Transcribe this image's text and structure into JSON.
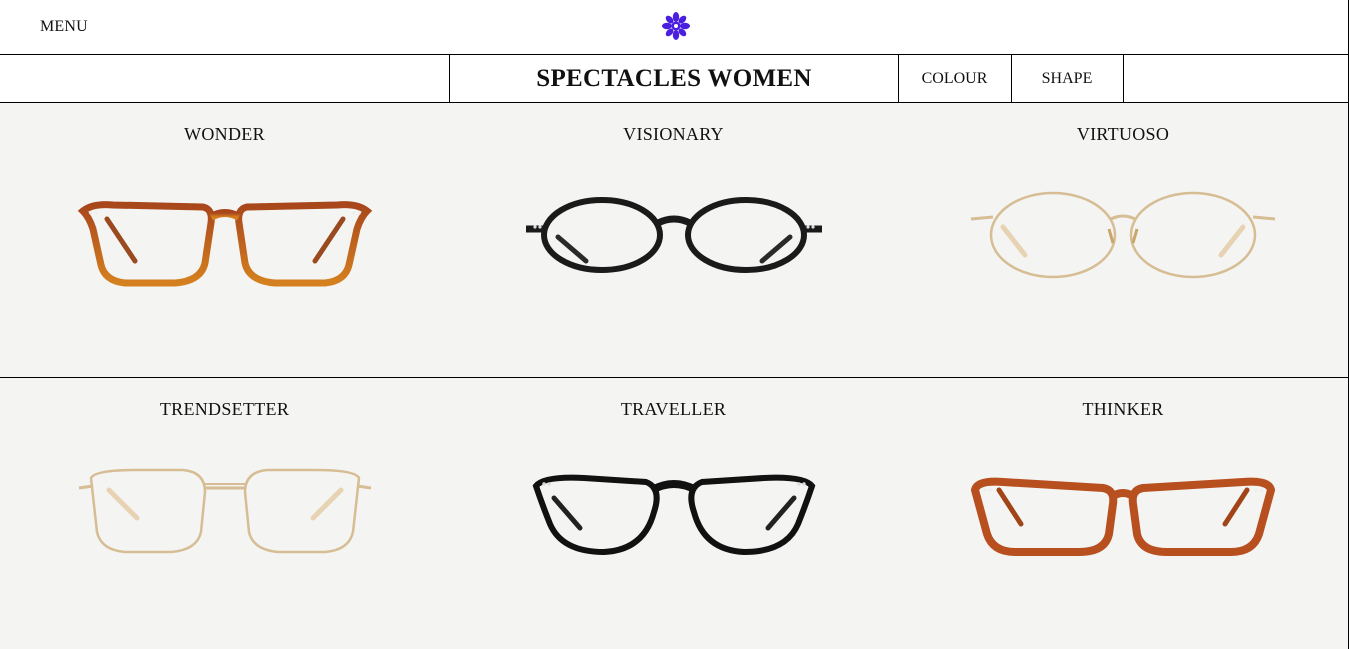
{
  "header": {
    "menu_label": "MENU",
    "logo_icon": "flower-logo-icon",
    "logo_color": "#4a1fe0"
  },
  "filters": {
    "page_title": "SPECTACLES WOMEN",
    "colour_label": "COLOUR",
    "shape_label": "SHAPE"
  },
  "products": [
    {
      "name": "WONDER",
      "frame_color": "#b8571f",
      "style": "acetate-rounded-rect"
    },
    {
      "name": "VISIONARY",
      "frame_color": "#1a1a1a",
      "style": "acetate-oval"
    },
    {
      "name": "VIRTUOSO",
      "frame_color": "#d9c29a",
      "style": "metal-oval"
    },
    {
      "name": "TRENDSETTER",
      "frame_color": "#d9c29a",
      "style": "metal-rounded-rect"
    },
    {
      "name": "TRAVELLER",
      "frame_color": "#111111",
      "style": "acetate-panto"
    },
    {
      "name": "THINKER",
      "frame_color": "#b84f1e",
      "style": "acetate-rect"
    }
  ]
}
